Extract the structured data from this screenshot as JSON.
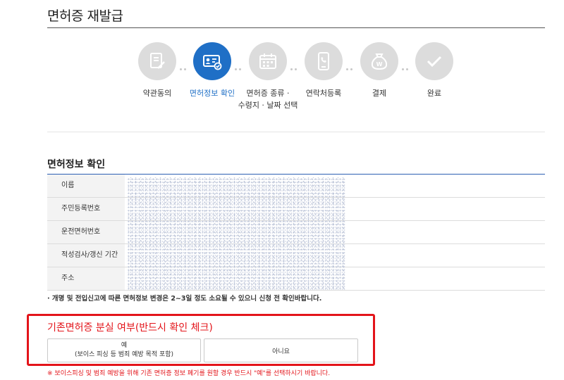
{
  "page": {
    "title": "면허증 재발급"
  },
  "steps": [
    {
      "label": "약관동의",
      "icon": "document-pen-icon",
      "active": false
    },
    {
      "label": "면허정보 확인",
      "icon": "id-card-check-icon",
      "active": true
    },
    {
      "label": "면허증 종류 · 수령지 · 날짜 선택",
      "label_line1": "면허증 종류 ·",
      "label_line2": "수령지 · 날짜 선택",
      "icon": "calendar-icon",
      "active": false
    },
    {
      "label": "연락처등록",
      "icon": "phone-icon",
      "active": false
    },
    {
      "label": "결제",
      "icon": "money-bag-icon",
      "active": false
    },
    {
      "label": "완료",
      "icon": "checkmark-icon",
      "active": false
    }
  ],
  "license_info": {
    "title": "면허정보 확인",
    "rows": [
      {
        "label": "이름"
      },
      {
        "label": "주민등록번호"
      },
      {
        "label": "운전면허번호"
      },
      {
        "label": "적성검사/갱신 기간"
      },
      {
        "label": "주소"
      }
    ],
    "notice": "· 개명 및 전입신고에 따른 면허정보 변경은 2~3일 정도 소요될 수 있으니 신청 전 확인바랍니다."
  },
  "lost_check": {
    "title": "기존면허증 분실 여부(반드시 확인 체크)",
    "yes_label": "예",
    "yes_sub": "(보이스 피싱 등 범죄 예방 목적 포함)",
    "no_label": "아니요",
    "warning": "※ 보이스피싱 및 범죄 예방을 위해 기존 면허증 정보 폐기를 원할 경우 반드시 \"예\"를 선택하시기 바랍니다."
  },
  "colors": {
    "accent": "#1f6fc6",
    "step_inactive": "#dcdcdc",
    "alert": "#e3141a"
  }
}
